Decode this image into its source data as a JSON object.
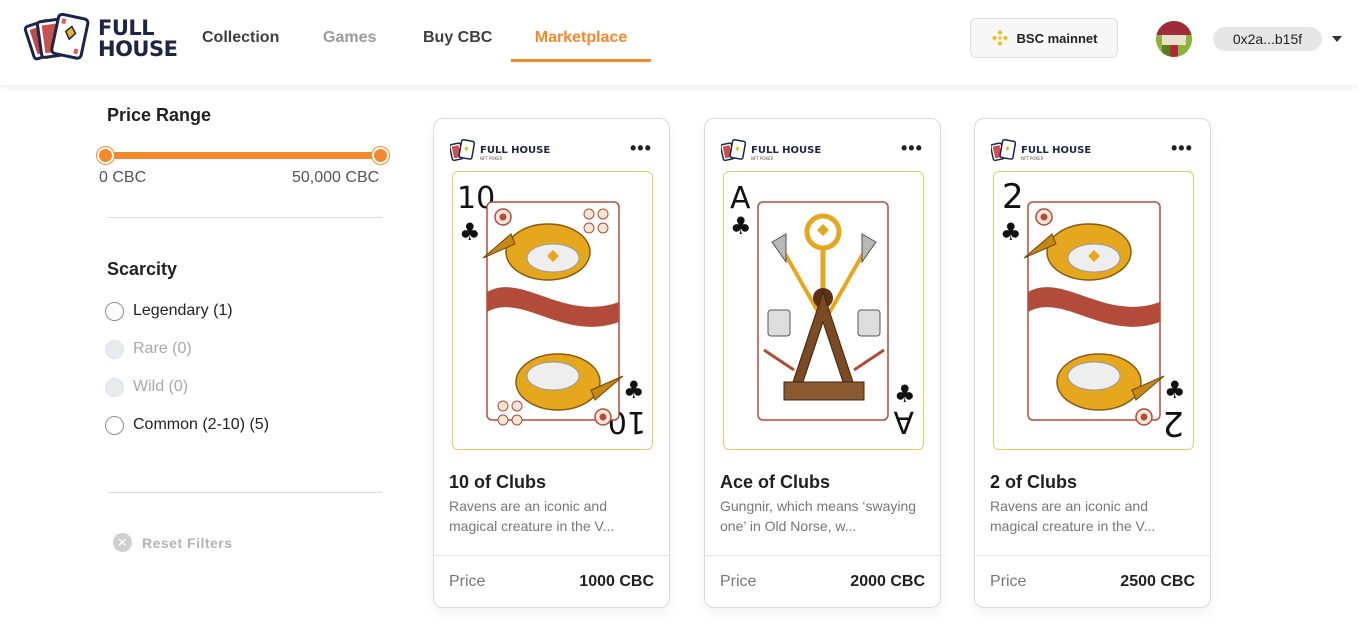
{
  "header": {
    "logo_line1": "FULL",
    "logo_line2": "HOUSE",
    "nav": [
      {
        "label": "Collection",
        "state": "normal"
      },
      {
        "label": "Games",
        "state": "muted"
      },
      {
        "label": "Buy CBC",
        "state": "normal"
      },
      {
        "label": "Marketplace",
        "state": "active"
      }
    ],
    "network": {
      "label": "BSC mainnet",
      "icon": "binance-icon"
    },
    "wallet_address": "0x2a...b15f",
    "dropdown_icon": "caret-down-icon"
  },
  "filters": {
    "price_range": {
      "title": "Price Range",
      "min_label": "0 CBC",
      "max_label": "50,000 CBC",
      "selected_min_fraction": 0,
      "selected_max_fraction": 1
    },
    "scarcity": {
      "title": "Scarcity",
      "options": [
        {
          "label": "Legendary (1)",
          "enabled": true,
          "checked": false
        },
        {
          "label": "Rare (0)",
          "enabled": false,
          "checked": false
        },
        {
          "label": "Wild (0)",
          "enabled": false,
          "checked": false
        },
        {
          "label": "Common (2-10) (5)",
          "enabled": true,
          "checked": false
        }
      ]
    },
    "reset_label": "Reset Filters"
  },
  "cards": [
    {
      "rank": "10",
      "suit": "♣",
      "brand_line1": "FULL HOUSE",
      "brand_line2": "NFT POKER",
      "name": "10 of Clubs",
      "description": "Ravens are an iconic and magical creature in the V...",
      "price_label": "Price",
      "price": "1000 CBC",
      "art": "raven"
    },
    {
      "rank": "A",
      "suit": "♣",
      "brand_line1": "FULL HOUSE",
      "brand_line2": "NFT POKER",
      "name": "Ace of Clubs",
      "description": "Gungnir, which means ‘swaying one’ in Old Norse, w...",
      "price_label": "Price",
      "price": "2000 CBC",
      "art": "spear-rack"
    },
    {
      "rank": "2",
      "suit": "♣",
      "brand_line1": "FULL HOUSE",
      "brand_line2": "NFT POKER",
      "name": "2 of Clubs",
      "description": "Ravens are an iconic and magical creature in the V...",
      "price_label": "Price",
      "price": "2500 CBC",
      "art": "raven"
    }
  ],
  "colors": {
    "accent": "#f4892b",
    "brand_navy": "#1c2547",
    "card_gold": "#e5a71e",
    "card_maroon": "#b34b3a"
  }
}
